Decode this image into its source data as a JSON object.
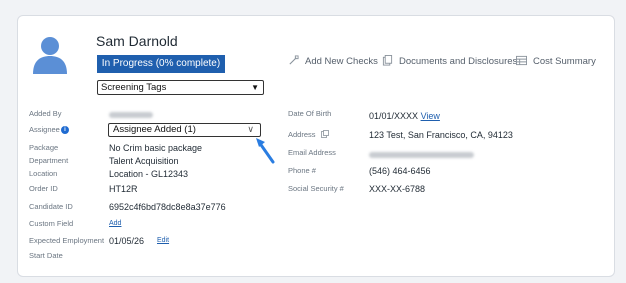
{
  "profile": {
    "name": "Sam Darnold",
    "status": "In Progress (0% complete)",
    "screening_tags": "Screening Tags"
  },
  "actions": {
    "add_checks": "Add New Checks",
    "documents": "Documents and Disclosures",
    "cost_summary": "Cost Summary"
  },
  "left": {
    "added_by_label": "Added By",
    "assignee_label": "Assignee",
    "assignee_value": "Assignee Added (1)",
    "package_label": "Package",
    "package_value": "No Crim basic package",
    "department_label": "Department",
    "department_value": "Talent Acquisition",
    "location_label": "Location",
    "location_value": "Location - GL12343",
    "order_id_label": "Order ID",
    "order_id_value": "HT12R",
    "candidate_id_label": "Candidate ID",
    "candidate_id_value": "6952c4f6bd78dc8e8a37e776",
    "custom_field_label": "Custom Field",
    "custom_field_link": "Add",
    "expected_employment_label": "Expected Employment",
    "start_date_label": "Start Date",
    "start_date_value": "01/05/26",
    "start_date_link": "Edit"
  },
  "right": {
    "dob_label": "Date Of Birth",
    "dob_value": "01/01/XXXX",
    "dob_link": "View",
    "address_label": "Address",
    "address_value": "123 Test, San Francisco, CA, 94123",
    "email_label": "Email Address",
    "phone_label": "Phone #",
    "phone_value": "(546) 464-6456",
    "ssn_label": "Social Security #",
    "ssn_value": "XXX-XX-6788"
  },
  "colors": {
    "accent": "#1f5fae",
    "background": "#f1f3f6",
    "card": "#ffffff"
  }
}
